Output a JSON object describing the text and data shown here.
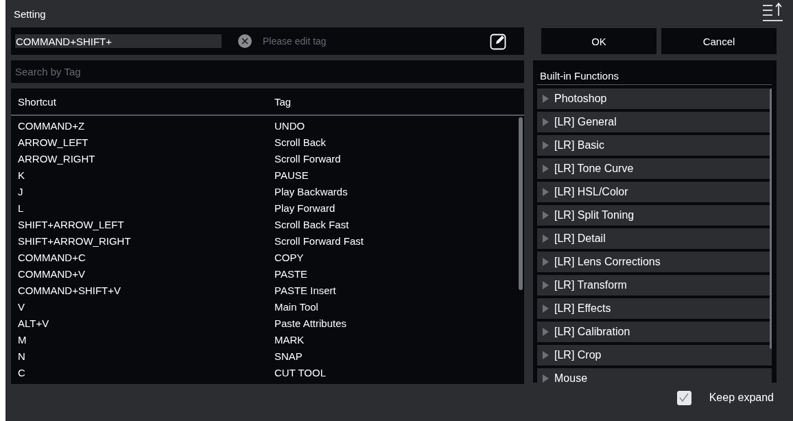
{
  "window": {
    "title": "Setting"
  },
  "shortcut_field": {
    "value": "COMMAND+SHIFT+"
  },
  "tag_field": {
    "placeholder": "Please edit tag"
  },
  "buttons": [
    {
      "label": "OK"
    },
    {
      "label": "Cancel"
    }
  ],
  "search": {
    "placeholder": "Search by Tag"
  },
  "table": {
    "columns": [
      "Shortcut",
      "Tag"
    ],
    "rows": [
      [
        "COMMAND+Z",
        "UNDO"
      ],
      [
        "ARROW_LEFT",
        "Scroll Back"
      ],
      [
        "ARROW_RIGHT",
        "Scroll Forward"
      ],
      [
        "K",
        "PAUSE"
      ],
      [
        "J",
        "Play Backwards"
      ],
      [
        "L",
        "Play Forward"
      ],
      [
        "SHIFT+ARROW_LEFT",
        "Scroll Back Fast"
      ],
      [
        "SHIFT+ARROW_RIGHT",
        "Scroll Forward Fast"
      ],
      [
        "COMMAND+C",
        "COPY"
      ],
      [
        "COMMAND+V",
        "PASTE"
      ],
      [
        "COMMAND+SHIFT+V",
        "PASTE Insert"
      ],
      [
        "V",
        "Main Tool"
      ],
      [
        "ALT+V",
        "Paste Attributes"
      ],
      [
        "M",
        "MARK"
      ],
      [
        "N",
        "SNAP"
      ],
      [
        "C",
        "CUT TOOL"
      ]
    ]
  },
  "functions": {
    "title": "Built-in Functions",
    "items": [
      {
        "label": "Photoshop",
        "expanded": false
      },
      {
        "label": "[LR] General",
        "expanded": false
      },
      {
        "label": "[LR] Basic",
        "expanded": false
      },
      {
        "label": "[LR] Tone Curve",
        "expanded": false
      },
      {
        "label": "[LR] HSL/Color",
        "expanded": false
      },
      {
        "label": "[LR] Split Toning",
        "expanded": false
      },
      {
        "label": "[LR] Detail",
        "expanded": false
      },
      {
        "label": "[LR] Lens Corrections",
        "expanded": false
      },
      {
        "label": "[LR] Transform",
        "expanded": false
      },
      {
        "label": "[LR] Effects",
        "expanded": false
      },
      {
        "label": "[LR] Calibration",
        "expanded": false
      },
      {
        "label": "[LR] Crop",
        "expanded": false
      },
      {
        "label": "Mouse",
        "expanded": false
      }
    ]
  },
  "keep_expand": {
    "label": "Keep expand",
    "checked": true
  }
}
